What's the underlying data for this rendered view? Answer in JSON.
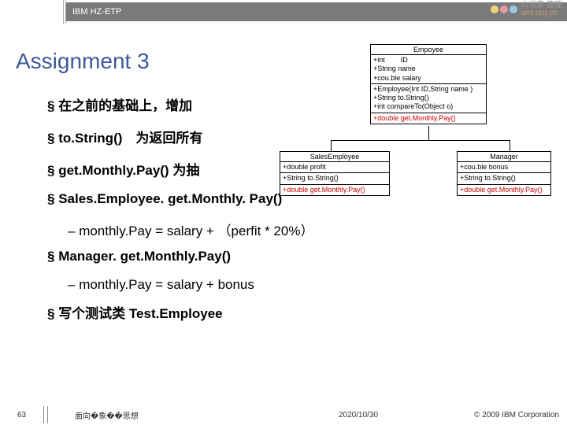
{
  "header": {
    "project": "IBM HZ-ETP"
  },
  "brand": {
    "line1": "火龙果  整理",
    "line2": "uml.org.cn"
  },
  "title": "Assignment 3",
  "bullets": {
    "b1": "在之前的基础上，增加",
    "b2": "to.String()　为返回所有",
    "b3": "get.Monthly.Pay()  为抽",
    "b4": "Sales.Employee. get.Monthly. Pay()",
    "s4": "monthly.Pay = salary +  （perfit * 20%）",
    "b5": "Manager. get.Monthly.Pay()",
    "s5": "monthly.Pay = salary + bonus",
    "b6": "写个测试类  Test.Employee"
  },
  "uml": {
    "employee": {
      "name": "Empoyee",
      "attrs": "+int        ID\n+String name\n+cou.ble salary",
      "methods": "+Employee(Int ID,String name )\n+String to.String()\n+int compareTo(Object o)",
      "red": "+double get.Monthly.Pay()"
    },
    "sales": {
      "name": "SalesEmployee",
      "attrs": "+double profit",
      "methods": "+String to.String()",
      "red": "+double get.Monthly.Pay()"
    },
    "manager": {
      "name": "Manager",
      "attrs": "+cou.ble bonus",
      "methods": "+String to.String()",
      "red": "+double get.Monthly.Pay()"
    }
  },
  "footer": {
    "page": "63",
    "subject": "面向�象��思想",
    "date": "2020/10/30",
    "copyright": "© 2009 IBM Corporation"
  }
}
